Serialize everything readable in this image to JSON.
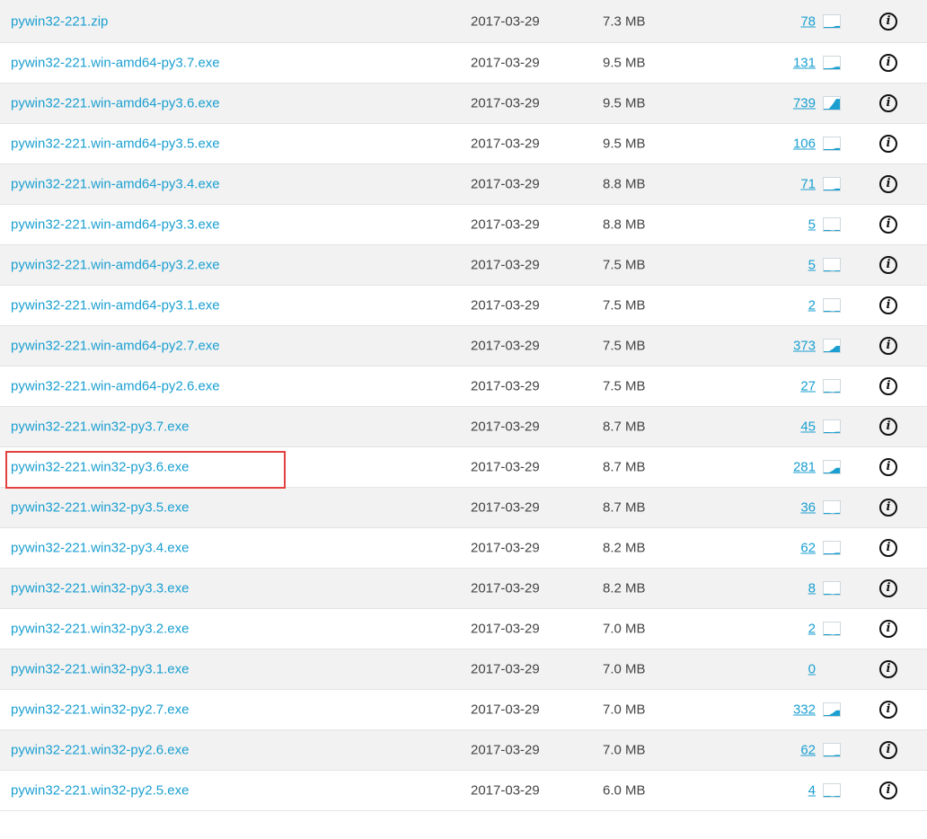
{
  "files": [
    {
      "name": "pywin32-221.zip",
      "date": "2017-03-29",
      "size": "7.3 MB",
      "downloads": "78",
      "trend": 0.15
    },
    {
      "name": "pywin32-221.win-amd64-py3.7.exe",
      "date": "2017-03-29",
      "size": "9.5 MB",
      "downloads": "131",
      "trend": 0.2
    },
    {
      "name": "pywin32-221.win-amd64-py3.6.exe",
      "date": "2017-03-29",
      "size": "9.5 MB",
      "downloads": "739",
      "trend": 0.85
    },
    {
      "name": "pywin32-221.win-amd64-py3.5.exe",
      "date": "2017-03-29",
      "size": "9.5 MB",
      "downloads": "106",
      "trend": 0.15
    },
    {
      "name": "pywin32-221.win-amd64-py3.4.exe",
      "date": "2017-03-29",
      "size": "8.8 MB",
      "downloads": "71",
      "trend": 0.15
    },
    {
      "name": "pywin32-221.win-amd64-py3.3.exe",
      "date": "2017-03-29",
      "size": "8.8 MB",
      "downloads": "5",
      "trend": 0.03
    },
    {
      "name": "pywin32-221.win-amd64-py3.2.exe",
      "date": "2017-03-29",
      "size": "7.5 MB",
      "downloads": "5",
      "trend": 0.03
    },
    {
      "name": "pywin32-221.win-amd64-py3.1.exe",
      "date": "2017-03-29",
      "size": "7.5 MB",
      "downloads": "2",
      "trend": 0.03
    },
    {
      "name": "pywin32-221.win-amd64-py2.7.exe",
      "date": "2017-03-29",
      "size": "7.5 MB",
      "downloads": "373",
      "trend": 0.5
    },
    {
      "name": "pywin32-221.win-amd64-py2.6.exe",
      "date": "2017-03-29",
      "size": "7.5 MB",
      "downloads": "27",
      "trend": 0.08
    },
    {
      "name": "pywin32-221.win32-py3.7.exe",
      "date": "2017-03-29",
      "size": "8.7 MB",
      "downloads": "45",
      "trend": 0.1
    },
    {
      "name": "pywin32-221.win32-py3.6.exe",
      "date": "2017-03-29",
      "size": "8.7 MB",
      "downloads": "281",
      "trend": 0.45
    },
    {
      "name": "pywin32-221.win32-py3.5.exe",
      "date": "2017-03-29",
      "size": "8.7 MB",
      "downloads": "36",
      "trend": 0.08
    },
    {
      "name": "pywin32-221.win32-py3.4.exe",
      "date": "2017-03-29",
      "size": "8.2 MB",
      "downloads": "62",
      "trend": 0.12
    },
    {
      "name": "pywin32-221.win32-py3.3.exe",
      "date": "2017-03-29",
      "size": "8.2 MB",
      "downloads": "8",
      "trend": 0.05
    },
    {
      "name": "pywin32-221.win32-py3.2.exe",
      "date": "2017-03-29",
      "size": "7.0 MB",
      "downloads": "2",
      "trend": 0.03
    },
    {
      "name": "pywin32-221.win32-py3.1.exe",
      "date": "2017-03-29",
      "size": "7.0 MB",
      "downloads": "0",
      "trend": null
    },
    {
      "name": "pywin32-221.win32-py2.7.exe",
      "date": "2017-03-29",
      "size": "7.0 MB",
      "downloads": "332",
      "trend": 0.45
    },
    {
      "name": "pywin32-221.win32-py2.6.exe",
      "date": "2017-03-29",
      "size": "7.0 MB",
      "downloads": "62",
      "trend": 0.12
    },
    {
      "name": "pywin32-221.win32-py2.5.exe",
      "date": "2017-03-29",
      "size": "6.0 MB",
      "downloads": "4",
      "trend": 0.05
    }
  ],
  "info_glyph": "i",
  "highlighted_file": "pywin32-221.win32-py3.6.exe",
  "colors": {
    "link": "#1a9fd0",
    "row_alt": "#f2f2f2",
    "highlight": "#e34040",
    "spark_fill": "#1a9fd0"
  }
}
